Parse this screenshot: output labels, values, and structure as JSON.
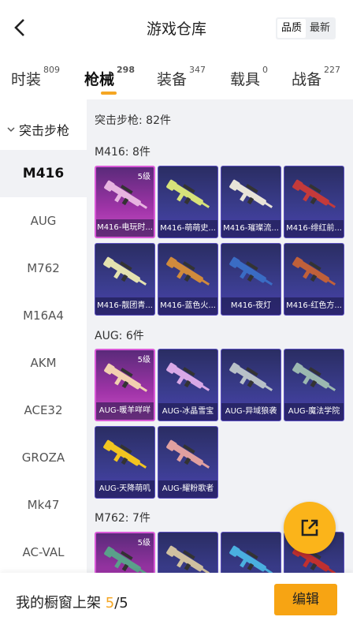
{
  "header": {
    "title": "游戏仓库",
    "sort_options": [
      {
        "label": "品质",
        "active": true
      },
      {
        "label": "最新",
        "active": false
      }
    ]
  },
  "tabs": [
    {
      "label": "时装",
      "count": "809",
      "active": false
    },
    {
      "label": "枪械",
      "count": "298",
      "active": true
    },
    {
      "label": "装备",
      "count": "347",
      "active": false
    },
    {
      "label": "载具",
      "count": "0",
      "active": false
    },
    {
      "label": "战备",
      "count": "227",
      "active": false
    }
  ],
  "accent_color": "#f5a623",
  "sidebar": {
    "category": "突击步枪",
    "items": [
      "M416",
      "AUG",
      "M762",
      "M16A4",
      "AKM",
      "ACE32",
      "GROZA",
      "Mk47",
      "AC-VAL"
    ],
    "active": "M416"
  },
  "content": {
    "total_label": "突击步枪: 82件",
    "sections": [
      {
        "label": "M416: 8件",
        "items": [
          {
            "name": "M416-电玩时...",
            "level": "5级",
            "quality": "purple",
            "gun_color": "#e7b4e0"
          },
          {
            "name": "M416-萌萌史...",
            "level": "",
            "quality": "blue",
            "gun_color": "#d7e27a"
          },
          {
            "name": "M416-璀璨流...",
            "level": "",
            "quality": "blue",
            "gun_color": "#e8e4d8"
          },
          {
            "name": "M416-绯红前...",
            "level": "",
            "quality": "blue",
            "gun_color": "#c43a3a"
          },
          {
            "name": "M416-靓团青...",
            "level": "",
            "quality": "blue",
            "gun_color": "#e4e2b0"
          },
          {
            "name": "M416-蓝色火...",
            "level": "",
            "quality": "blue",
            "gun_color": "#d08a3c"
          },
          {
            "name": "M416-夜灯",
            "level": "",
            "quality": "blue",
            "gun_color": "#3a6cc4"
          },
          {
            "name": "M416-红色方...",
            "level": "",
            "quality": "blue",
            "gun_color": "#c0603a"
          }
        ]
      },
      {
        "label": "AUG: 6件",
        "items": [
          {
            "name": "AUG-暖羊咩咩",
            "level": "5级",
            "quality": "purple",
            "gun_color": "#f2d0b0"
          },
          {
            "name": "AUG-冰晶雪宝",
            "level": "",
            "quality": "blue",
            "gun_color": "#d9a8e6"
          },
          {
            "name": "AUG-异域狼袭",
            "level": "",
            "quality": "blue",
            "gun_color": "#b8c0c8"
          },
          {
            "name": "AUG-魔法学院",
            "level": "",
            "quality": "blue",
            "gun_color": "#9bb8b0"
          },
          {
            "name": "AUG-天降萌叽",
            "level": "",
            "quality": "blue",
            "gun_color": "#f2c420"
          },
          {
            "name": "AUG-耀粉歌者",
            "level": "",
            "quality": "blue",
            "gun_color": "#e0a0a0"
          }
        ]
      },
      {
        "label": "M762: 7件",
        "items": [
          {
            "name": "",
            "level": "5级",
            "quality": "purple",
            "gun_color": "#5aa08a"
          },
          {
            "name": "",
            "level": "",
            "quality": "blue",
            "gun_color": "#d0c0a0"
          },
          {
            "name": "",
            "level": "",
            "quality": "blue",
            "gun_color": "#4ab0e0"
          },
          {
            "name": "",
            "level": "",
            "quality": "blue",
            "gun_color": "#c03030"
          }
        ]
      }
    ]
  },
  "bottom": {
    "showcase_label": "我的橱窗上架",
    "showcase_count": "5",
    "showcase_total": "/5",
    "edit_label": "编辑"
  }
}
